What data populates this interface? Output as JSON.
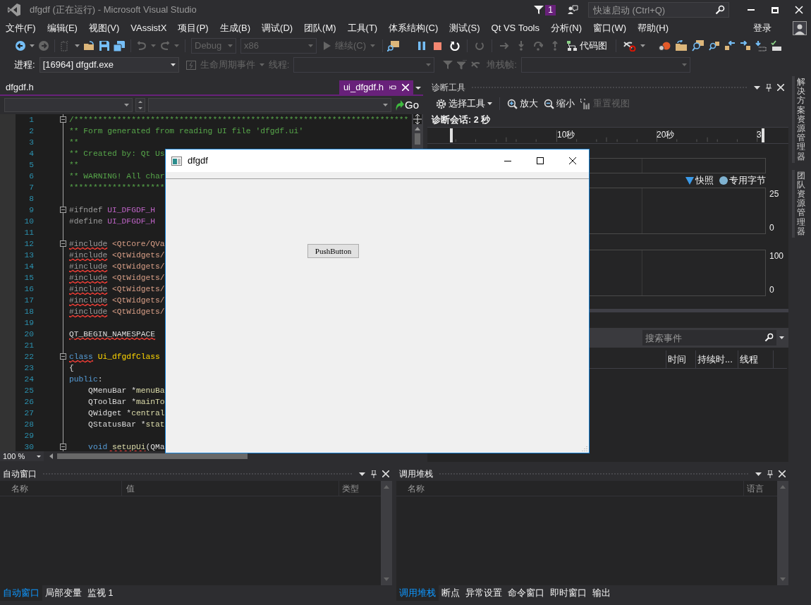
{
  "window": {
    "title": "dfgdf (正在运行) - Microsoft Visual Studio",
    "notification_count": "1",
    "quick_launch": {
      "placeholder": "快速启动 (Ctrl+Q)"
    }
  },
  "menu": [
    "文件(F)",
    "编辑(E)",
    "视图(V)",
    "VAssistX",
    "项目(P)",
    "生成(B)",
    "调试(D)",
    "团队(M)",
    "工具(T)",
    "体系结构(C)",
    "测试(S)",
    "Qt VS Tools",
    "分析(N)",
    "窗口(W)",
    "帮助(H)"
  ],
  "sign_in": "登录",
  "standard_toolbar": {
    "configuration": {
      "value": "Debug",
      "disabled": true
    },
    "platform": {
      "value": "x86",
      "disabled": true
    },
    "continue": {
      "label": "继续(C)",
      "disabled": true
    },
    "code_map": {
      "label": "代码图",
      "disabled": false
    }
  },
  "debug_location": {
    "process_label": "进程:",
    "process": "[16964] dfgdf.exe",
    "lifecycle_events": {
      "label": "生命周期事件",
      "disabled": true
    },
    "thread_label": "线程:",
    "stack_frame_label": "堆栈帧:"
  },
  "editor": {
    "tabs": [
      {
        "label": "dfgdf.h",
        "selected": false
      },
      {
        "label": "ui_dfgdf.h",
        "selected": true
      }
    ],
    "go_button": "Go",
    "zoom": "100 %",
    "lines": [
      {
        "number": "1",
        "fold": true,
        "segments": [
          {
            "text": "/**********************************************************************",
            "kind": "comment",
            "error": false
          }
        ]
      },
      {
        "number": "2",
        "fold": false,
        "segments": [
          {
            "text": "** Form generated from reading UI file 'dfgdf.ui'",
            "kind": "comment",
            "error": false
          }
        ]
      },
      {
        "number": "3",
        "fold": false,
        "segments": [
          {
            "text": "**",
            "kind": "comment",
            "error": false
          }
        ]
      },
      {
        "number": "4",
        "fold": false,
        "segments": [
          {
            "text": "** Created by: Qt Us",
            "kind": "comment",
            "error": false
          }
        ]
      },
      {
        "number": "5",
        "fold": false,
        "segments": [
          {
            "text": "**",
            "kind": "comment",
            "error": false
          }
        ]
      },
      {
        "number": "6",
        "fold": false,
        "segments": [
          {
            "text": "** WARNING! All char",
            "kind": "comment",
            "error": false
          }
        ]
      },
      {
        "number": "7",
        "fold": false,
        "segments": [
          {
            "text": "********************",
            "kind": "comment",
            "error": false
          }
        ]
      },
      {
        "number": "8",
        "fold": false
      },
      {
        "number": "9",
        "fold": true,
        "segments": [
          {
            "text": "#ifndef",
            "kind": "directive",
            "error": false
          },
          {
            "text": " UI_DFGDF_H",
            "kind": "macro",
            "error": false
          }
        ]
      },
      {
        "number": "10",
        "fold": false,
        "segments": [
          {
            "text": "#define",
            "kind": "directive",
            "error": false
          },
          {
            "text": " UI_DFGDF_H",
            "kind": "macro",
            "error": false
          }
        ]
      },
      {
        "number": "11",
        "fold": false
      },
      {
        "number": "12",
        "fold": true,
        "segments": [
          {
            "text": "#include",
            "kind": "directive",
            "error": true
          },
          {
            "text": " <QtCore/QVa",
            "kind": "path",
            "error": false
          }
        ]
      },
      {
        "number": "13",
        "fold": false,
        "segments": [
          {
            "text": "#include",
            "kind": "directive",
            "error": true
          },
          {
            "text": " <QtWidgets/",
            "kind": "path",
            "error": false
          }
        ]
      },
      {
        "number": "14",
        "fold": false,
        "segments": [
          {
            "text": "#include",
            "kind": "directive",
            "error": true
          },
          {
            "text": " <QtWidgets/",
            "kind": "path",
            "error": false
          }
        ]
      },
      {
        "number": "15",
        "fold": false,
        "segments": [
          {
            "text": "#include",
            "kind": "directive",
            "error": true
          },
          {
            "text": " <QtWidgets/",
            "kind": "path",
            "error": false
          }
        ]
      },
      {
        "number": "16",
        "fold": false,
        "segments": [
          {
            "text": "#include",
            "kind": "directive",
            "error": true
          },
          {
            "text": " <QtWidgets/",
            "kind": "path",
            "error": false
          }
        ]
      },
      {
        "number": "17",
        "fold": false,
        "segments": [
          {
            "text": "#include",
            "kind": "directive",
            "error": true
          },
          {
            "text": " <QtWidgets/",
            "kind": "path",
            "error": false
          }
        ]
      },
      {
        "number": "18",
        "fold": false,
        "segments": [
          {
            "text": "#include",
            "kind": "directive",
            "error": true
          },
          {
            "text": " <QtWidgets/",
            "kind": "path",
            "error": false
          }
        ]
      },
      {
        "number": "19",
        "fold": false
      },
      {
        "number": "20",
        "fold": false,
        "segments": [
          {
            "text": "QT_BEGIN_NAMESPACE",
            "kind": "plain",
            "error": true
          }
        ]
      },
      {
        "number": "21",
        "fold": false
      },
      {
        "number": "22",
        "fold": true,
        "segments": [
          {
            "text": "class",
            "kind": "keyword",
            "error": true
          },
          {
            "text": " Ui_dfgdfClass",
            "kind": "type",
            "error": false
          }
        ]
      },
      {
        "number": "23",
        "fold": false,
        "segments": [
          {
            "text": "{",
            "kind": "plain",
            "error": false
          }
        ]
      },
      {
        "number": "24",
        "fold": false,
        "segments": [
          {
            "text": "public",
            "kind": "keyword",
            "error": false
          },
          {
            "text": ":",
            "kind": "plain",
            "error": false
          }
        ]
      },
      {
        "number": "25",
        "fold": false,
        "segments": [
          {
            "text": "    QMenuBar *",
            "kind": "plain",
            "error": false
          },
          {
            "text": "menuBa",
            "kind": "member",
            "error": false
          }
        ]
      },
      {
        "number": "26",
        "fold": false,
        "segments": [
          {
            "text": "    QToolBar *",
            "kind": "plain",
            "error": false
          },
          {
            "text": "mainTo",
            "kind": "member",
            "error": false
          }
        ]
      },
      {
        "number": "27",
        "fold": false,
        "segments": [
          {
            "text": "    QWidget *",
            "kind": "plain",
            "error": false
          },
          {
            "text": "central",
            "kind": "member",
            "error": false
          }
        ]
      },
      {
        "number": "28",
        "fold": false,
        "segments": [
          {
            "text": "    QStatusBar *",
            "kind": "plain",
            "error": false
          },
          {
            "text": "stat",
            "kind": "member",
            "error": false
          }
        ]
      },
      {
        "number": "29",
        "fold": false
      },
      {
        "number": "30",
        "fold": true,
        "segments": [
          {
            "text": "    void",
            "kind": "keyword",
            "error": false
          },
          {
            "text": " setupUi",
            "kind": "member",
            "error": true
          },
          {
            "text": "(QMa",
            "kind": "plain",
            "error": false
          }
        ]
      }
    ]
  },
  "diagnostics": {
    "title": "诊断工具",
    "toolbar": [
      {
        "label": "选择工具",
        "kind": "select",
        "disabled": false
      },
      {
        "label": "放大",
        "kind": "zoom_in",
        "disabled": false
      },
      {
        "label": "缩小",
        "kind": "zoom_out",
        "disabled": false
      },
      {
        "label": "重置视图",
        "kind": "reset",
        "disabled": true
      }
    ],
    "session": "诊断会话: 2 秒",
    "ruler_labels": [
      "10秒",
      "20秒",
      "3"
    ],
    "legend": [
      {
        "label": "快照",
        "kind": "triangle",
        "color": "#3b9ae8"
      },
      {
        "label": "专用字节",
        "kind": "circle",
        "color": "#7fb2d0"
      }
    ],
    "chart_1_axis": [
      "25",
      "0"
    ],
    "chart_2_axis": [
      "100",
      "0"
    ],
    "search": {
      "placeholder": "搜索事件"
    },
    "columns": [
      "时间",
      "持续时...",
      "线程"
    ]
  },
  "app_window": {
    "title": "dfgdf",
    "button": "PushButton"
  },
  "autos": {
    "title": "自动窗口",
    "columns": [
      "名称",
      "值",
      "类型"
    ]
  },
  "call_stack": {
    "title": "调用堆栈",
    "columns": [
      "名称",
      "语言"
    ]
  },
  "bottom_left_tabs": [
    {
      "label": "自动窗口",
      "selected": true
    },
    {
      "label": "局部变量",
      "selected": false
    },
    {
      "label": "监视 1",
      "selected": false
    }
  ],
  "bottom_right_tabs": [
    {
      "label": "调用堆栈",
      "selected": true
    },
    {
      "label": "断点",
      "selected": false
    },
    {
      "label": "异常设置",
      "selected": false
    },
    {
      "label": "命令窗口",
      "selected": false
    },
    {
      "label": "即时窗口",
      "selected": false
    },
    {
      "label": "输出",
      "selected": false
    }
  ],
  "side_tabs": [
    "解决方案资源管理器",
    "团队资源管理器"
  ]
}
